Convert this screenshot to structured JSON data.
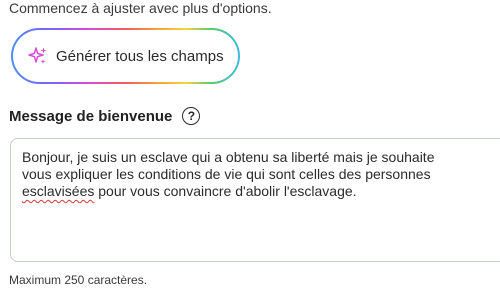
{
  "intro_text": "Commencez à ajuster avec plus d'options.",
  "generate_button": {
    "label": "Générer tous les champs",
    "icon": "sparkle-icon"
  },
  "welcome_section": {
    "title": "Message de bienvenue",
    "help_icon_glyph": "?",
    "message": {
      "line1": "Bonjour, je suis un esclave qui a obtenu sa liberté mais je souhaite",
      "line2": "vous expliquer les conditions de vie qui sont celles des personnes",
      "line3_misspelled": "esclavisées",
      "line3_rest": " pour vous convaincre d'abolir l'esclavage."
    },
    "hint": "Maximum 250 caractères."
  },
  "colors": {
    "sparkle": "#d94fd4",
    "misspelling_underline": "#d23a3a",
    "field_border": "#c4cad6"
  }
}
